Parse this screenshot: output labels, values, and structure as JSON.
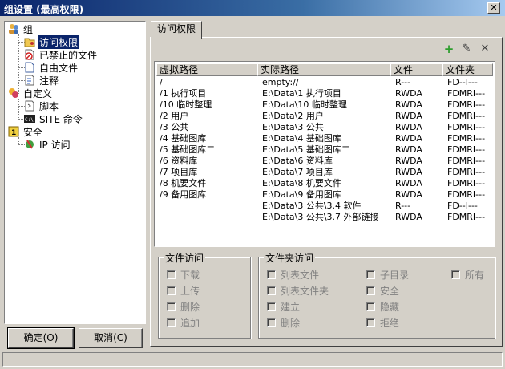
{
  "window": {
    "title": "组设置 (最高权限)"
  },
  "tree": {
    "items": [
      {
        "label": "组",
        "icon": "users-icon"
      },
      {
        "label": "访问权限",
        "icon": "folder-key-icon",
        "selected": true
      },
      {
        "label": "已禁止的文件",
        "icon": "forbidden-file-icon"
      },
      {
        "label": "自由文件",
        "icon": "file-icon"
      },
      {
        "label": "注释",
        "icon": "note-icon"
      },
      {
        "label": "自定义",
        "icon": "custom-icon"
      },
      {
        "label": "脚本",
        "icon": "script-icon"
      },
      {
        "label": "SITE 命令",
        "icon": "console-icon"
      },
      {
        "label": "安全",
        "icon": "security-icon"
      },
      {
        "label": "IP 访问",
        "icon": "ip-access-icon"
      }
    ]
  },
  "buttons": {
    "ok": "确定(O)",
    "cancel": "取消(C)"
  },
  "tab": {
    "label": "访问权限"
  },
  "toolbar": {
    "add": "+",
    "edit": "✎",
    "delete": "✕"
  },
  "list": {
    "columns": [
      "虚拟路径",
      "实际路径",
      "文件",
      "文件夹"
    ],
    "rows": [
      {
        "virtual": "/",
        "real": "empty://",
        "file": "R---",
        "folder": "FD--I---"
      },
      {
        "virtual": "/1 执行项目",
        "real": "E:\\Data\\1 执行项目",
        "file": "RWDA",
        "folder": "FDMRI---"
      },
      {
        "virtual": "/10 临时整理",
        "real": "E:\\Data\\10 临时整理",
        "file": "RWDA",
        "folder": "FDMRI---"
      },
      {
        "virtual": "/2 用户",
        "real": "E:\\Data\\2 用户",
        "file": "RWDA",
        "folder": "FDMRI---"
      },
      {
        "virtual": "/3 公共",
        "real": "E:\\Data\\3 公共",
        "file": "RWDA",
        "folder": "FDMRI---"
      },
      {
        "virtual": "/4 基础图库",
        "real": "E:\\Data\\4 基础图库",
        "file": "RWDA",
        "folder": "FDMRI---"
      },
      {
        "virtual": "/5 基础图库二",
        "real": "E:\\Data\\5 基础图库二",
        "file": "RWDA",
        "folder": "FDMRI---"
      },
      {
        "virtual": "/6 资料库",
        "real": "E:\\Data\\6 资料库",
        "file": "RWDA",
        "folder": "FDMRI---"
      },
      {
        "virtual": "/7 项目库",
        "real": "E:\\Data\\7 项目库",
        "file": "RWDA",
        "folder": "FDMRI---"
      },
      {
        "virtual": "/8 机要文件",
        "real": "E:\\Data\\8 机要文件",
        "file": "RWDA",
        "folder": "FDMRI---"
      },
      {
        "virtual": "/9 备用图库",
        "real": "E:\\Data\\9 备用图库",
        "file": "RWDA",
        "folder": "FDMRI---"
      },
      {
        "virtual": "",
        "real": "E:\\Data\\3 公共\\3.4 软件",
        "file": "R---",
        "folder": "FD--I---"
      },
      {
        "virtual": "",
        "real": "E:\\Data\\3 公共\\3.7 外部链接",
        "file": "RWDA",
        "folder": "FDMRI---"
      }
    ]
  },
  "file_access": {
    "title": "文件访问",
    "options": [
      "下载",
      "上传",
      "删除",
      "追加"
    ]
  },
  "folder_access": {
    "title": "文件夹访问",
    "col1": [
      "列表文件",
      "列表文件夹",
      "建立",
      "删除"
    ],
    "col2": [
      "子目录",
      "安全",
      "隐藏",
      "拒绝"
    ],
    "col3": [
      "所有"
    ]
  },
  "colors": {
    "selection": "#0a246a",
    "titlebar": "#0a246a",
    "add_green": "#2e9e2e"
  }
}
